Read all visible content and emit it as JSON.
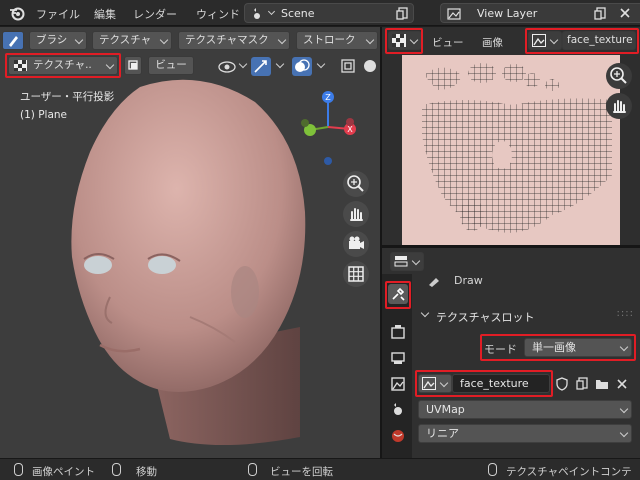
{
  "topbar": {
    "menu": [
      "ファイル",
      "編集",
      "レンダー",
      "ウィンド"
    ],
    "scene_name": "Scene",
    "view_layer_name": "View Layer"
  },
  "viewport": {
    "tool_tabs": [
      "ブラシ",
      "テクスチャ",
      "テクスチャマスク",
      "ストローク"
    ],
    "mode_dropdown": "テクスチャ..",
    "view_button": "ビュー",
    "view_name": "ユーザー・平行投影",
    "object_name": "(1) Plane",
    "gizmo": {
      "x": "X",
      "y": "Y",
      "z": "Z"
    }
  },
  "image_editor": {
    "menu": [
      "ビュー",
      "画像"
    ],
    "image_name": "face_texture"
  },
  "properties": {
    "brush_name": "Draw",
    "panel_title": "テクスチャスロット",
    "mode_label": "モード",
    "mode_value": "単一画像",
    "image_name": "face_texture",
    "uv_map": "UVMap",
    "interpolation": "リニア"
  },
  "statusbar": {
    "left_action": "画像ペイント",
    "middle_action": "移動",
    "right_action": "ビューを回転",
    "context": "テクスチャペイントコンテ"
  },
  "colors": {
    "highlight": "#e11d25",
    "accent_blue": "#4772b3",
    "skin": "#c89d97",
    "texture_bg": "#e7c8c2"
  }
}
